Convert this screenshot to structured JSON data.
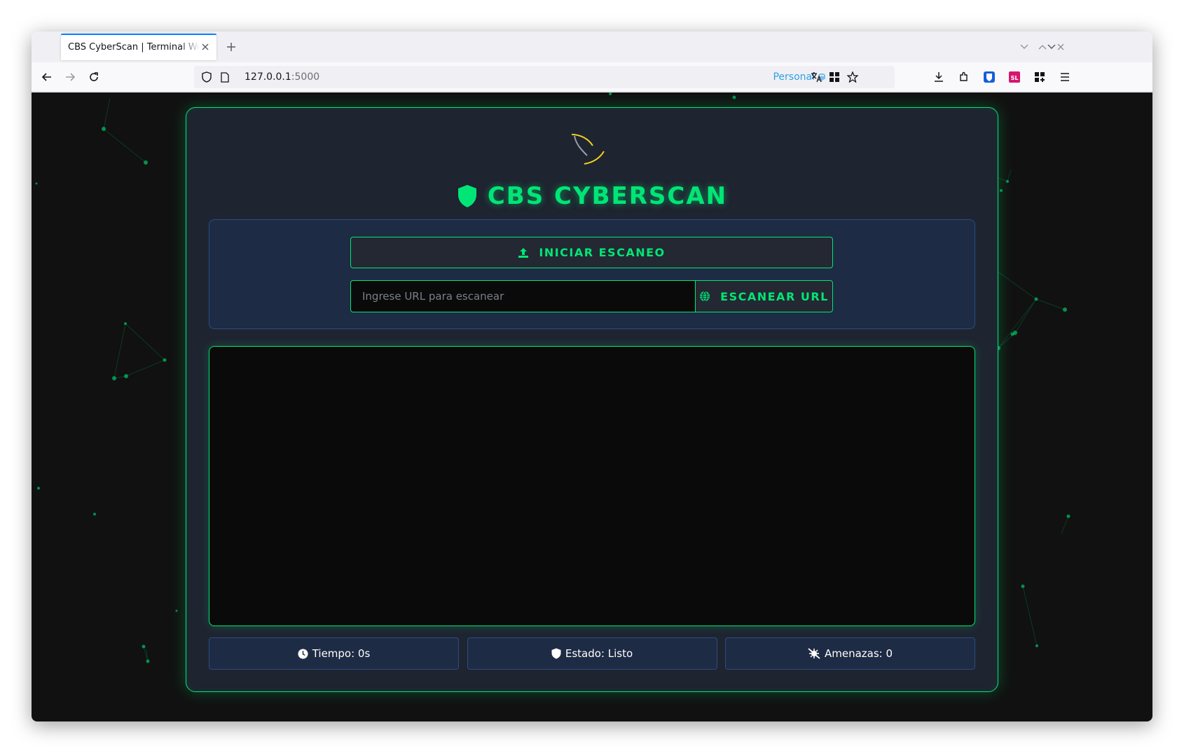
{
  "browser": {
    "tab_title": "CBS CyberScan | Terminal Web",
    "url_host": "127.0.0.1",
    "url_port": ":5000",
    "profile_label": "Personal"
  },
  "app": {
    "title": "CBS CYBERSCAN",
    "accent_color": "#00e676",
    "panel_color": "#1e2b44",
    "spinner_color": "#f5d020",
    "upload_button_label": "INICIAR ESCANEO",
    "url_placeholder": "Ingrese URL para escanear",
    "url_value": "",
    "scan_url_button_label": "ESCANEAR URL",
    "status": {
      "time_label": "Tiempo: 0s",
      "state_label": "Estado: Listo",
      "threats_label": "Amenazas: 0"
    }
  },
  "icons": {
    "shield": "shield-icon",
    "upload": "upload-icon",
    "globe": "globe-icon",
    "clock": "clock-icon",
    "virus_slash": "virus-slash-icon"
  }
}
